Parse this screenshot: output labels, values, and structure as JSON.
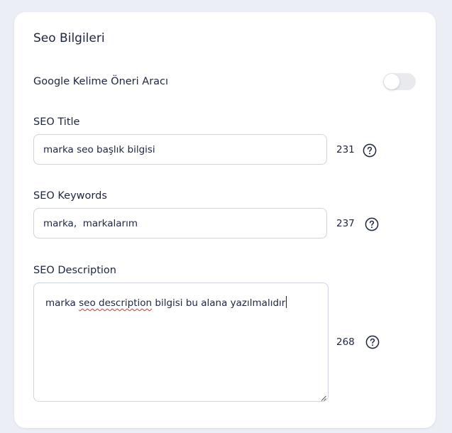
{
  "card": {
    "title": "Seo Bilgileri",
    "google_tool": {
      "label": "Google Kelime Öneri Aracı",
      "enabled": false
    },
    "seo_title": {
      "label": "SEO Title",
      "value": "marka seo başlık bilgisi",
      "count": "231"
    },
    "seo_keywords": {
      "label": "SEO Keywords",
      "value": "marka,  markalarım",
      "count": "237"
    },
    "seo_description": {
      "label": "SEO Description",
      "value_part1": "marka ",
      "value_spell": "seo description",
      "value_part2": " bilgisi bu alana yazılmalıdır",
      "count": "268"
    }
  },
  "icons": {
    "help": "question-circle-icon",
    "resize": "resize-handle-icon"
  },
  "colors": {
    "background": "#eceef6",
    "card": "#ffffff",
    "text": "#1d2540",
    "border": "#cfd3dd",
    "toggle_off": "#e9eaee",
    "spell_error": "#e03030"
  }
}
